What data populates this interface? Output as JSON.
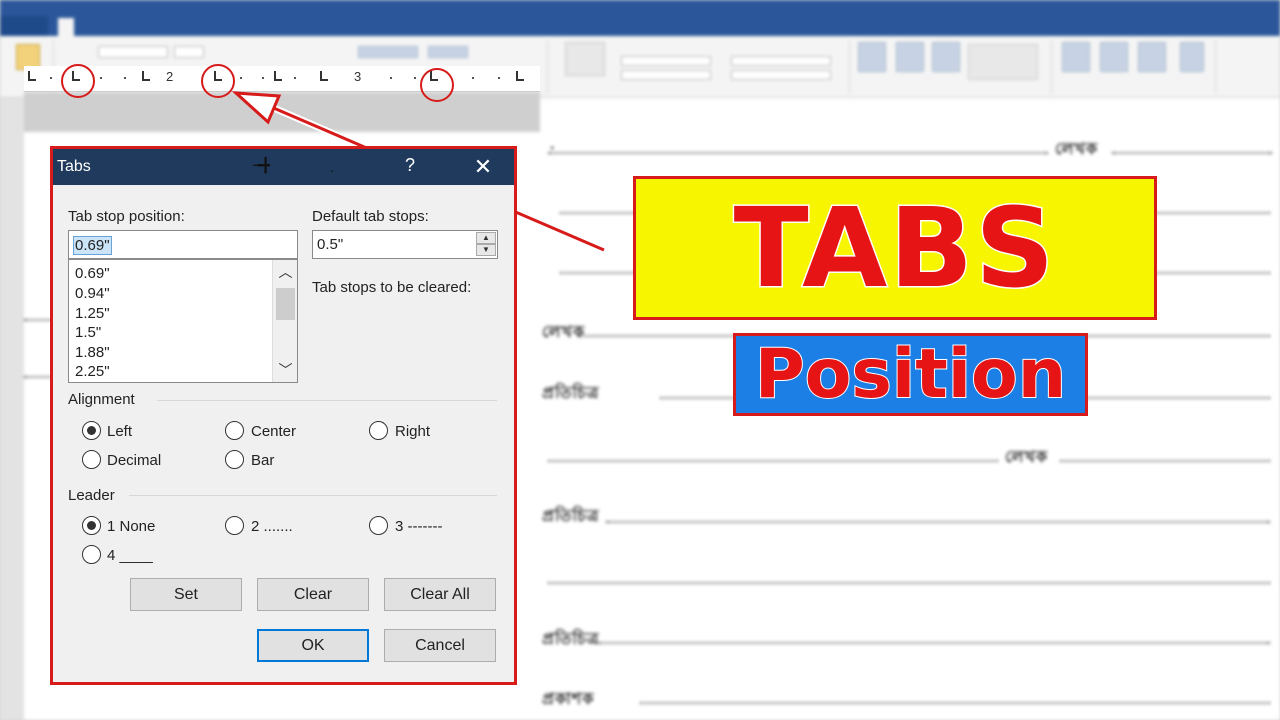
{
  "dialog": {
    "title": "Tabs",
    "help_glyph": "?",
    "close_glyph": "✕",
    "tab_stop_position_label": "Tab stop position:",
    "tab_stop_position_value": "0.69\"",
    "default_tab_stops_label": "Default tab stops:",
    "default_tab_stops_value": "0.5\"",
    "tab_stops_to_clear_label": "Tab stops to be cleared:",
    "tab_stop_list": [
      "0.69\"",
      "0.94\"",
      "1.25\"",
      "1.5\"",
      "1.88\"",
      "2.25\""
    ],
    "alignment_label": "Alignment",
    "alignment_options": [
      "Left",
      "Center",
      "Right",
      "Decimal",
      "Bar"
    ],
    "alignment_selected": "Left",
    "leader_label": "Leader",
    "leader_options": [
      "1 None",
      "2 .......",
      "3 -------",
      "4 ____"
    ],
    "leader_selected": "1 None",
    "buttons": {
      "set": "Set",
      "clear": "Clear",
      "clear_all": "Clear All",
      "ok": "OK",
      "cancel": "Cancel"
    }
  },
  "ruler": {
    "numbers": [
      "2",
      "3"
    ]
  },
  "overlay": {
    "title": "TABS",
    "subtitle": "Position",
    "accent_red": "#d71a1a",
    "title_bg": "#f8f500",
    "subtitle_bg": "#1b7fe6"
  }
}
